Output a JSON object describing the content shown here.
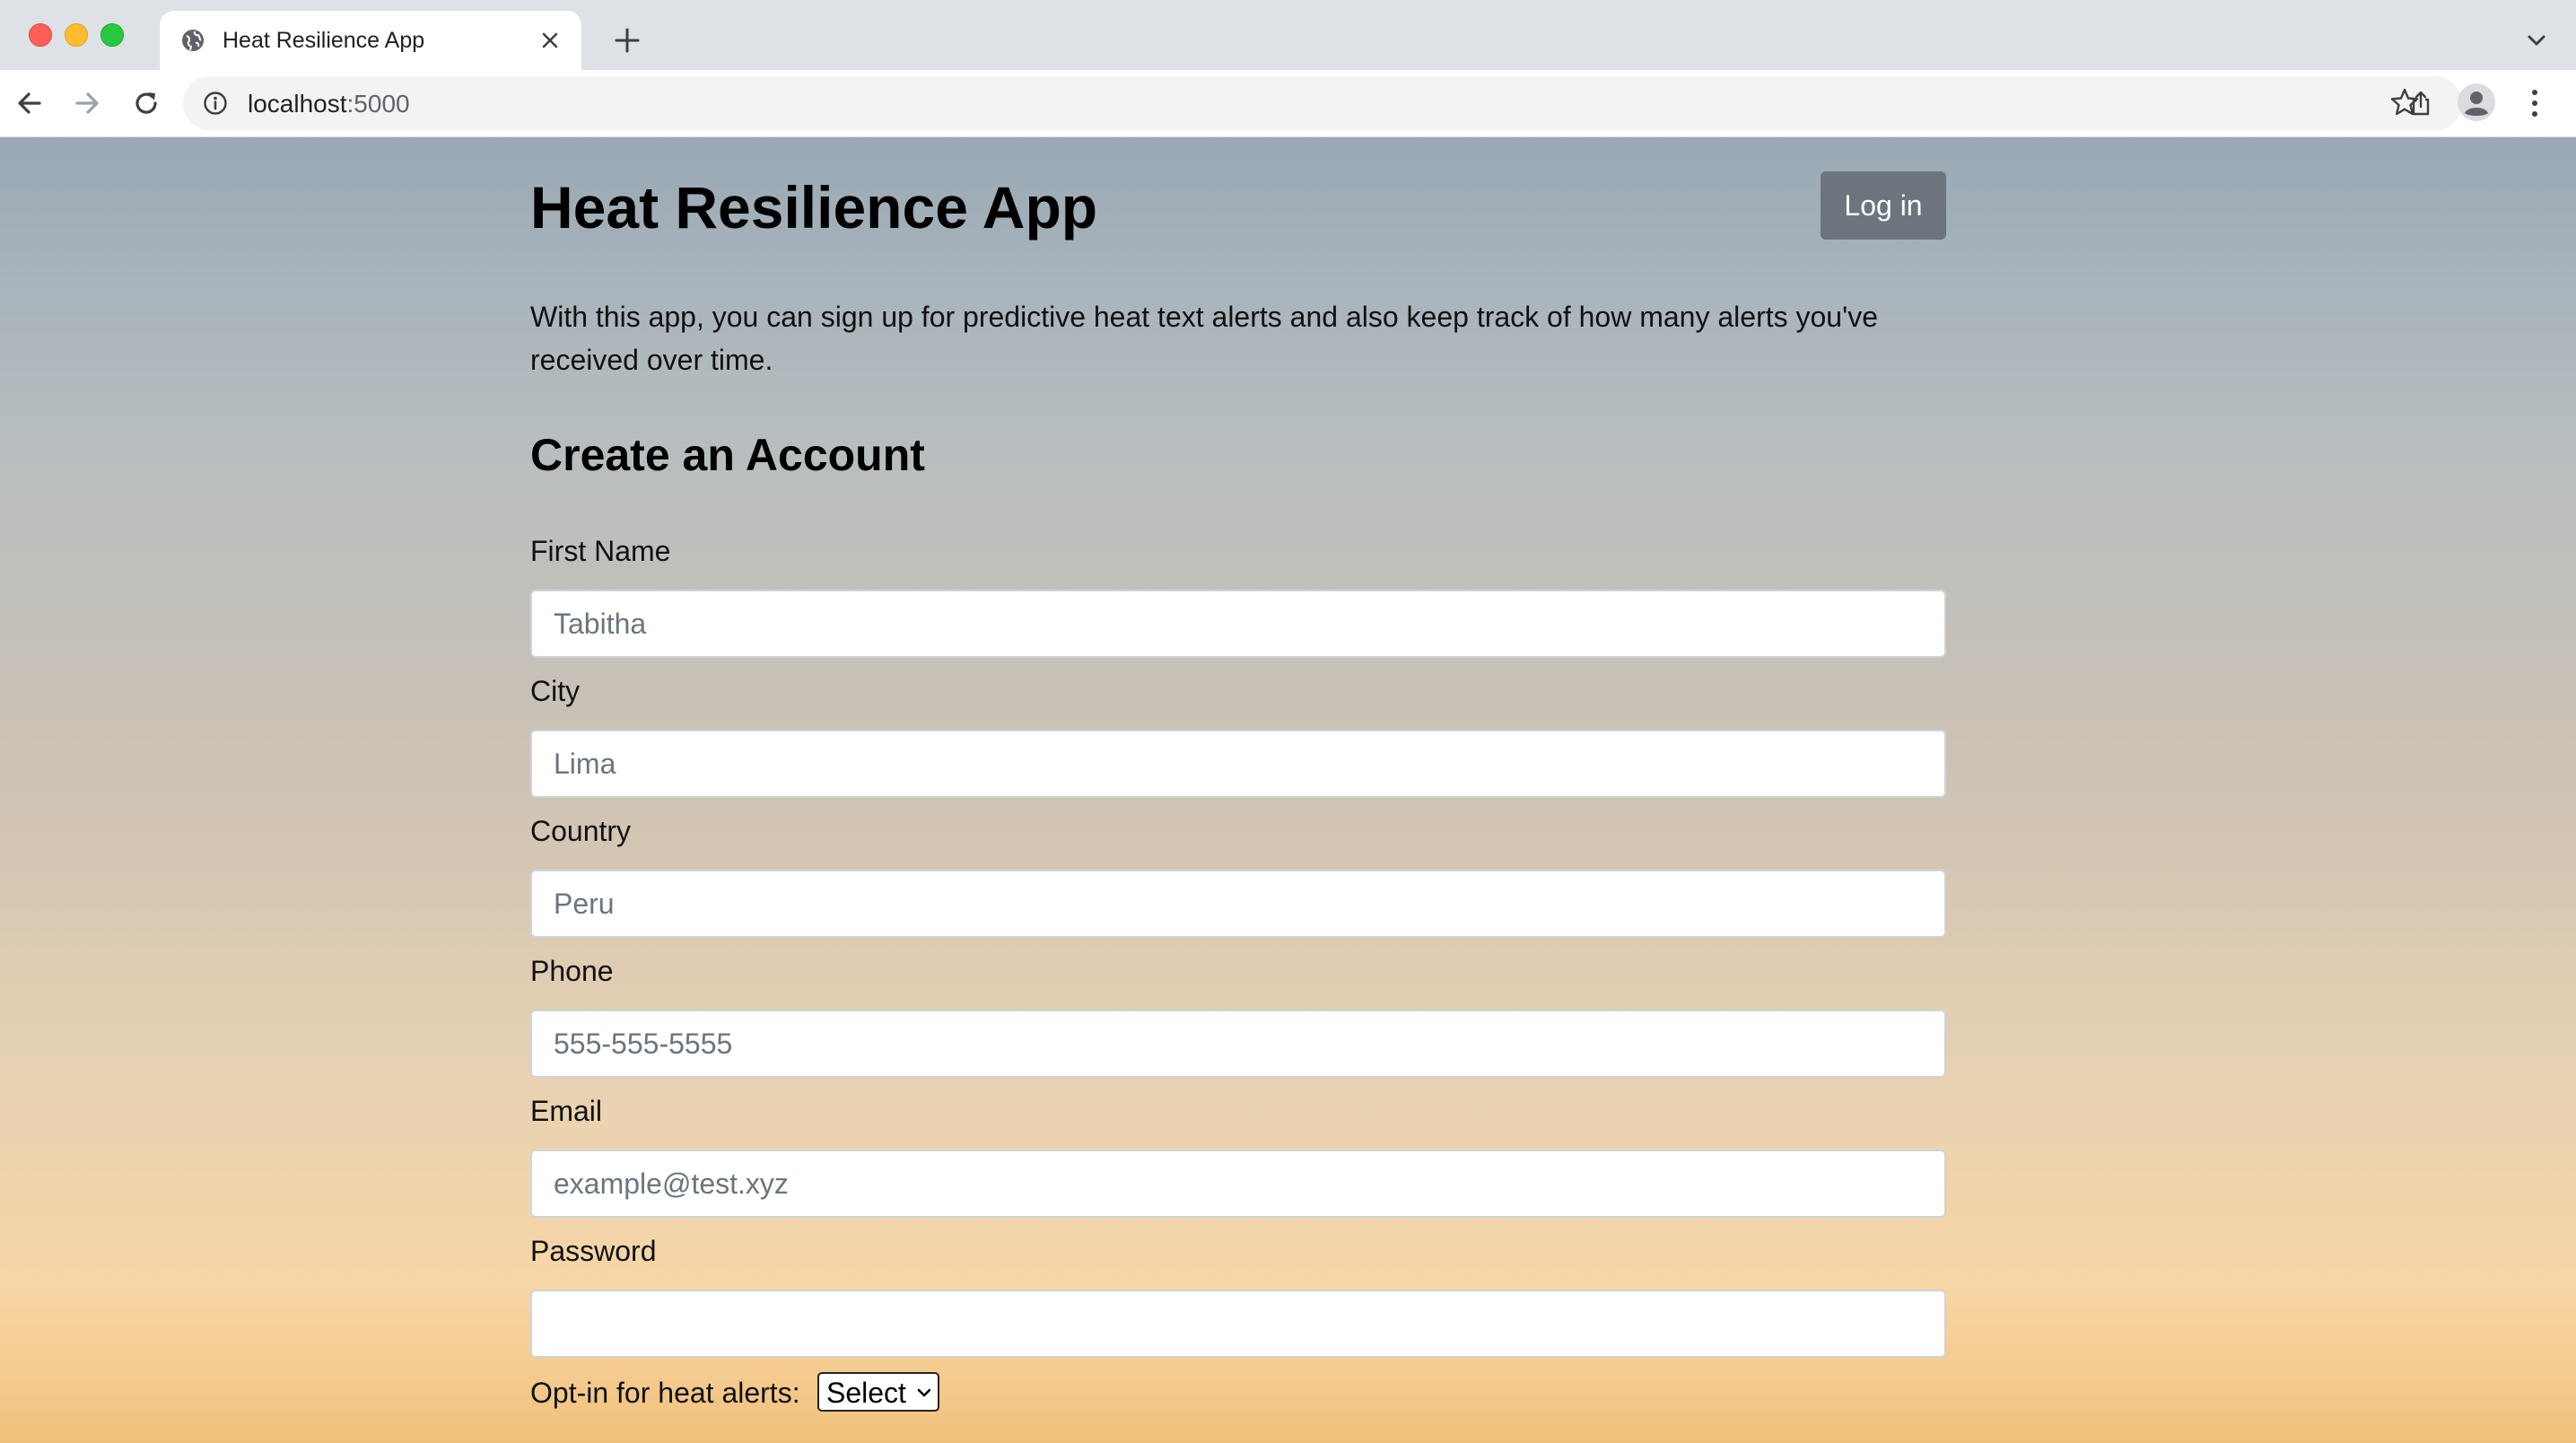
{
  "browser": {
    "tab_title": "Heat Resilience App",
    "url_host": "localhost",
    "url_port": ":5000"
  },
  "page": {
    "title": "Heat Resilience App",
    "login_label": "Log in",
    "intro": "With this app, you can sign up for predictive heat text alerts and also keep track of how many alerts you've received over time.",
    "form_title": "Create an Account",
    "fields": [
      {
        "label": "First Name",
        "placeholder": "Tabitha",
        "value": ""
      },
      {
        "label": "City",
        "placeholder": "Lima",
        "value": ""
      },
      {
        "label": "Country",
        "placeholder": "Peru",
        "value": ""
      },
      {
        "label": "Phone",
        "placeholder": "555-555-5555",
        "value": ""
      },
      {
        "label": "Email",
        "placeholder": "example@test.xyz",
        "value": ""
      },
      {
        "label": "Password",
        "placeholder": "",
        "value": ""
      }
    ],
    "optin": {
      "label": "Opt-in for heat alerts:",
      "selected": "Select"
    }
  },
  "colors": {
    "login_button": "#6c757d",
    "gradient_top": "#9aa9b5",
    "gradient_bottom": "#f1c17c"
  },
  "icons": {
    "favicon": "globe-icon",
    "tab_close": "close-icon",
    "new_tab": "plus-icon",
    "tab_search": "chevron-down-icon",
    "back": "back-arrow-icon",
    "forward": "forward-arrow-icon",
    "reload": "reload-icon",
    "site_info": "info-icon",
    "share": "share-icon",
    "bookmark": "star-icon",
    "profile": "profile-icon",
    "menu": "kebab-menu-icon"
  }
}
